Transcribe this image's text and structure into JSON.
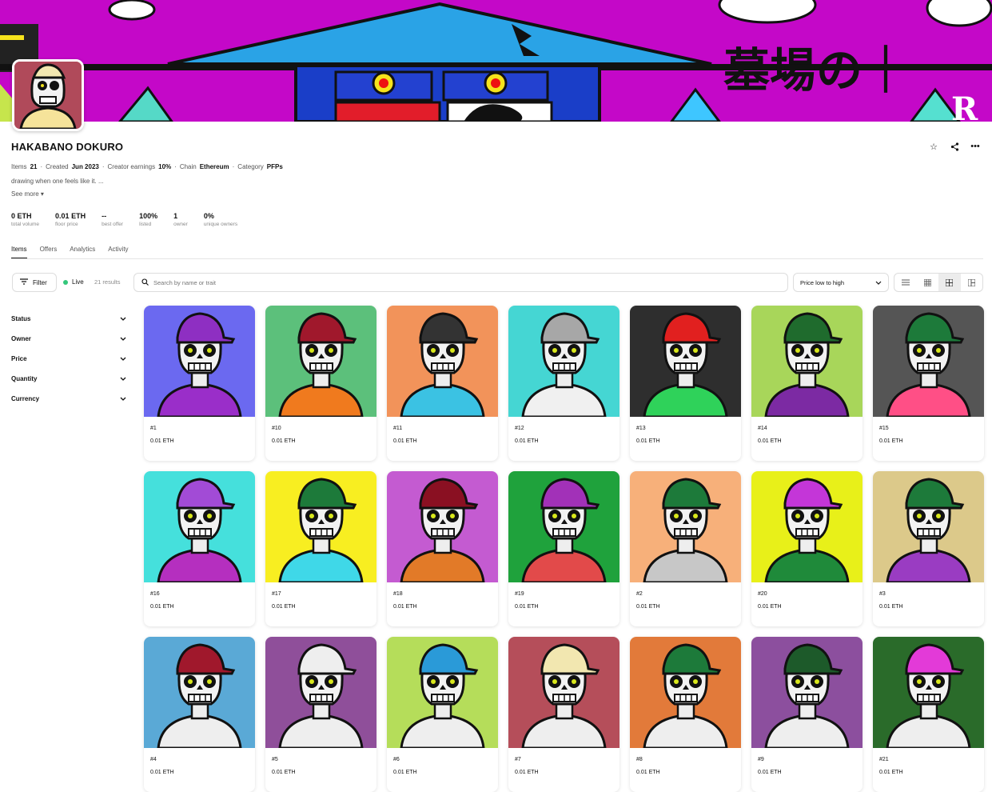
{
  "collection": {
    "name": "HAKABANO DOKURO",
    "description": "drawing when one feels like it. ...",
    "see_more": "See more ▾"
  },
  "meta": {
    "items_label": "Items",
    "items_value": "21",
    "created_label": "Created",
    "created_value": "Jun 2023",
    "earnings_label": "Creator earnings",
    "earnings_value": "10%",
    "chain_label": "Chain",
    "chain_value": "Ethereum",
    "category_label": "Category",
    "category_value": "PFPs",
    "sep": "·"
  },
  "stats": [
    {
      "value": "0 ETH",
      "label": "total volume"
    },
    {
      "value": "0.01 ETH",
      "label": "floor price"
    },
    {
      "value": "--",
      "label": "best offer"
    },
    {
      "value": "100%",
      "label": "listed"
    },
    {
      "value": "1",
      "label": "owner"
    },
    {
      "value": "0%",
      "label": "unique owners"
    }
  ],
  "tabs": [
    "Items",
    "Offers",
    "Analytics",
    "Activity"
  ],
  "toolbar": {
    "filter": "Filter",
    "live": "Live",
    "results": "21 results",
    "search_placeholder": "Search by name or trait",
    "sort": "Price low to high"
  },
  "filters": [
    "Status",
    "Owner",
    "Price",
    "Quantity",
    "Currency"
  ],
  "items": [
    {
      "name": "#1",
      "price": "0.01 ETH",
      "bg": "#6b69f0",
      "hat": "#8e2fc2",
      "shirt": "#9a2ec9"
    },
    {
      "name": "#10",
      "price": "0.01 ETH",
      "bg": "#5cc07b",
      "hat": "#a0182c",
      "shirt": "#f07a1e"
    },
    {
      "name": "#11",
      "price": "0.01 ETH",
      "bg": "#f2935a",
      "hat": "#333333",
      "shirt": "#3bc2e3"
    },
    {
      "name": "#12",
      "price": "0.01 ETH",
      "bg": "#45d6d3",
      "hat": "#a7a7a7",
      "shirt": "#f0f0f0"
    },
    {
      "name": "#13",
      "price": "0.01 ETH",
      "bg": "#2e2e2e",
      "hat": "#e1201f",
      "shirt": "#2fd25a"
    },
    {
      "name": "#14",
      "price": "0.01 ETH",
      "bg": "#a8d65a",
      "hat": "#1f6b2d",
      "shirt": "#7c2aa3"
    },
    {
      "name": "#15",
      "price": "0.01 ETH",
      "bg": "#555555",
      "hat": "#1d7a3a",
      "shirt": "#ff4f86"
    },
    {
      "name": "#16",
      "price": "0.01 ETH",
      "bg": "#45e0dc",
      "hat": "#a24bd6",
      "shirt": "#b52fbf"
    },
    {
      "name": "#17",
      "price": "0.01 ETH",
      "bg": "#f8ee21",
      "hat": "#1d7a3a",
      "shirt": "#3fd8e8"
    },
    {
      "name": "#18",
      "price": "0.01 ETH",
      "bg": "#c45bd1",
      "hat": "#8a1022",
      "shirt": "#e27a28"
    },
    {
      "name": "#19",
      "price": "0.01 ETH",
      "bg": "#1fa23c",
      "hat": "#a231b8",
      "shirt": "#e24a4a"
    },
    {
      "name": "#2",
      "price": "0.01 ETH",
      "bg": "#f7b07a",
      "hat": "#1d7a3a",
      "shirt": "#c7c7c7"
    },
    {
      "name": "#20",
      "price": "0.01 ETH",
      "bg": "#e8f019",
      "hat": "#c436d8",
      "shirt": "#1f8a3a"
    },
    {
      "name": "#3",
      "price": "0.01 ETH",
      "bg": "#dcc98a",
      "hat": "#1d7a3a",
      "shirt": "#9a3cc2"
    },
    {
      "name": "#4",
      "price": "0.01 ETH",
      "bg": "#5aa9d6",
      "hat": "#a0182c",
      "shirt": "#eeeeee"
    },
    {
      "name": "#5",
      "price": "0.01 ETH",
      "bg": "#8f4f9a",
      "hat": "#eeeeee",
      "shirt": "#eeeeee"
    },
    {
      "name": "#6",
      "price": "0.01 ETH",
      "bg": "#b5dd5a",
      "hat": "#2a9ad8",
      "shirt": "#eeeeee"
    },
    {
      "name": "#7",
      "price": "0.01 ETH",
      "bg": "#b54e5a",
      "hat": "#f2e7b0",
      "shirt": "#eeeeee"
    },
    {
      "name": "#8",
      "price": "0.01 ETH",
      "bg": "#e27a3a",
      "hat": "#1d7a3a",
      "shirt": "#eeeeee"
    },
    {
      "name": "#9",
      "price": "0.01 ETH",
      "bg": "#8c4f9e",
      "hat": "#1d5a2a",
      "shirt": "#eeeeee"
    },
    {
      "name": "#21",
      "price": "0.01 ETH",
      "bg": "#2a6b2a",
      "hat": "#e33ad8",
      "shirt": "#eeeeee"
    }
  ]
}
